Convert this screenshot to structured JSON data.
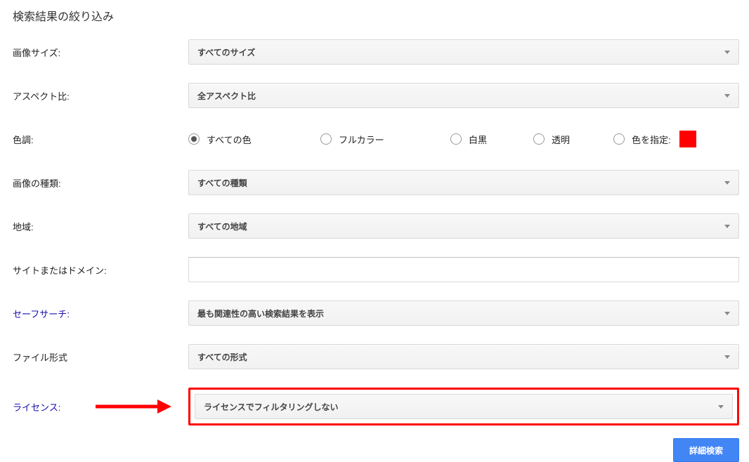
{
  "heading": "検索結果の絞り込み",
  "rows": {
    "imageSize": {
      "label": "画像サイズ:",
      "value": "すべてのサイズ"
    },
    "aspectRatio": {
      "label": "アスペクト比:",
      "value": "全アスペクト比"
    },
    "color": {
      "label": "色調:"
    },
    "imageType": {
      "label": "画像の種類:",
      "value": "すべての種類"
    },
    "region": {
      "label": "地域:",
      "value": "すべての地域"
    },
    "site": {
      "label": "サイトまたはドメイン:",
      "value": ""
    },
    "safeSearch": {
      "label": "セーフサーチ:",
      "value": "最も関連性の高い検索結果を表示"
    },
    "fileType": {
      "label": "ファイル形式",
      "value": "すべての形式"
    },
    "license": {
      "label": "ライセンス:",
      "value": "ライセンスでフィルタリングしない"
    }
  },
  "colorOptions": {
    "all": "すべての色",
    "fullColor": "フルカラー",
    "bw": "白黒",
    "trans": "透明",
    "specify": "色を指定:"
  },
  "colorSwatch": "#ff0000",
  "submitLabel": "詳細検索"
}
